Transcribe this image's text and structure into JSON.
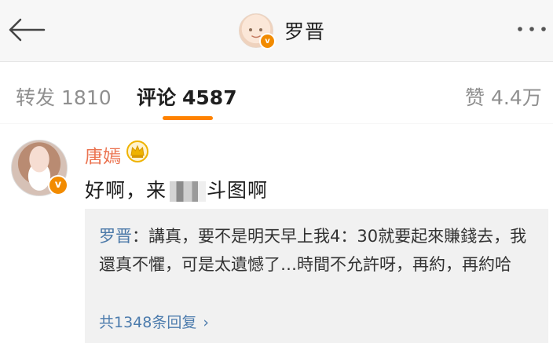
{
  "header": {
    "title": "罗晋",
    "back_icon": "back-arrow-icon",
    "more_icon": "more-dots-icon",
    "avatar_badge": "v"
  },
  "tabs": {
    "repost_label": "转发",
    "repost_count": "1810",
    "comment_label": "评论",
    "comment_count": "4587",
    "like_label": "赞",
    "like_count": "4.4万",
    "active_color": "#ff8200"
  },
  "comment": {
    "author": "唐嫣",
    "badge": "v",
    "crown_icon": "crown-icon",
    "text_before": "好啊，来",
    "text_after": "斗图啊",
    "reply_author": "罗晋",
    "reply_text": "：講真，要不是明天早上我4：30就要起來賺錢去，我還真不懼，可是太遺憾了…時間不允許呀，再約，再約哈",
    "more_replies": "共1348条回复",
    "more_arrow": "›",
    "name_color": "#eb7350",
    "link_color": "#4d7cad"
  }
}
